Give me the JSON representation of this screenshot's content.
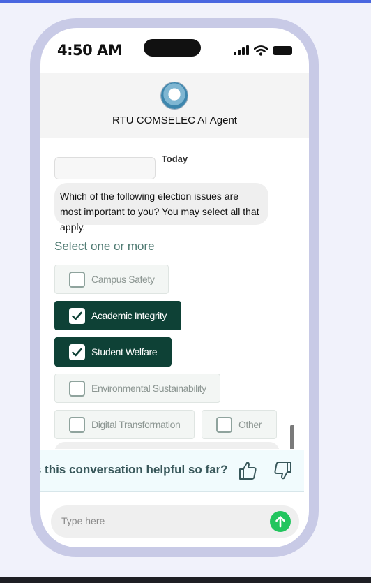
{
  "status_bar": {
    "time": "4:50 AM"
  },
  "header": {
    "title": "RTU COMSELEC AI Agent"
  },
  "chat": {
    "day_label": "Today",
    "bot_message": "Which of the following election issues are most important to you? You may select all that apply.",
    "select_hint": "Select one or more",
    "options": [
      {
        "label": "Campus Safety",
        "checked": false
      },
      {
        "label": "Academic Integrity",
        "checked": true
      },
      {
        "label": "Student Welfare",
        "checked": true
      },
      {
        "label": "Environmental Sustainability",
        "checked": false
      },
      {
        "label": "Digital Transformation",
        "checked": false
      },
      {
        "label": "Other",
        "checked": false
      }
    ]
  },
  "feedback": {
    "question": "Was this conversation helpful so far?"
  },
  "composer": {
    "placeholder": "Type here"
  },
  "colors": {
    "accent": "#0e4136",
    "send": "#22c55e",
    "frame": "#c8cae6",
    "top_strip": "#4a67e0"
  }
}
